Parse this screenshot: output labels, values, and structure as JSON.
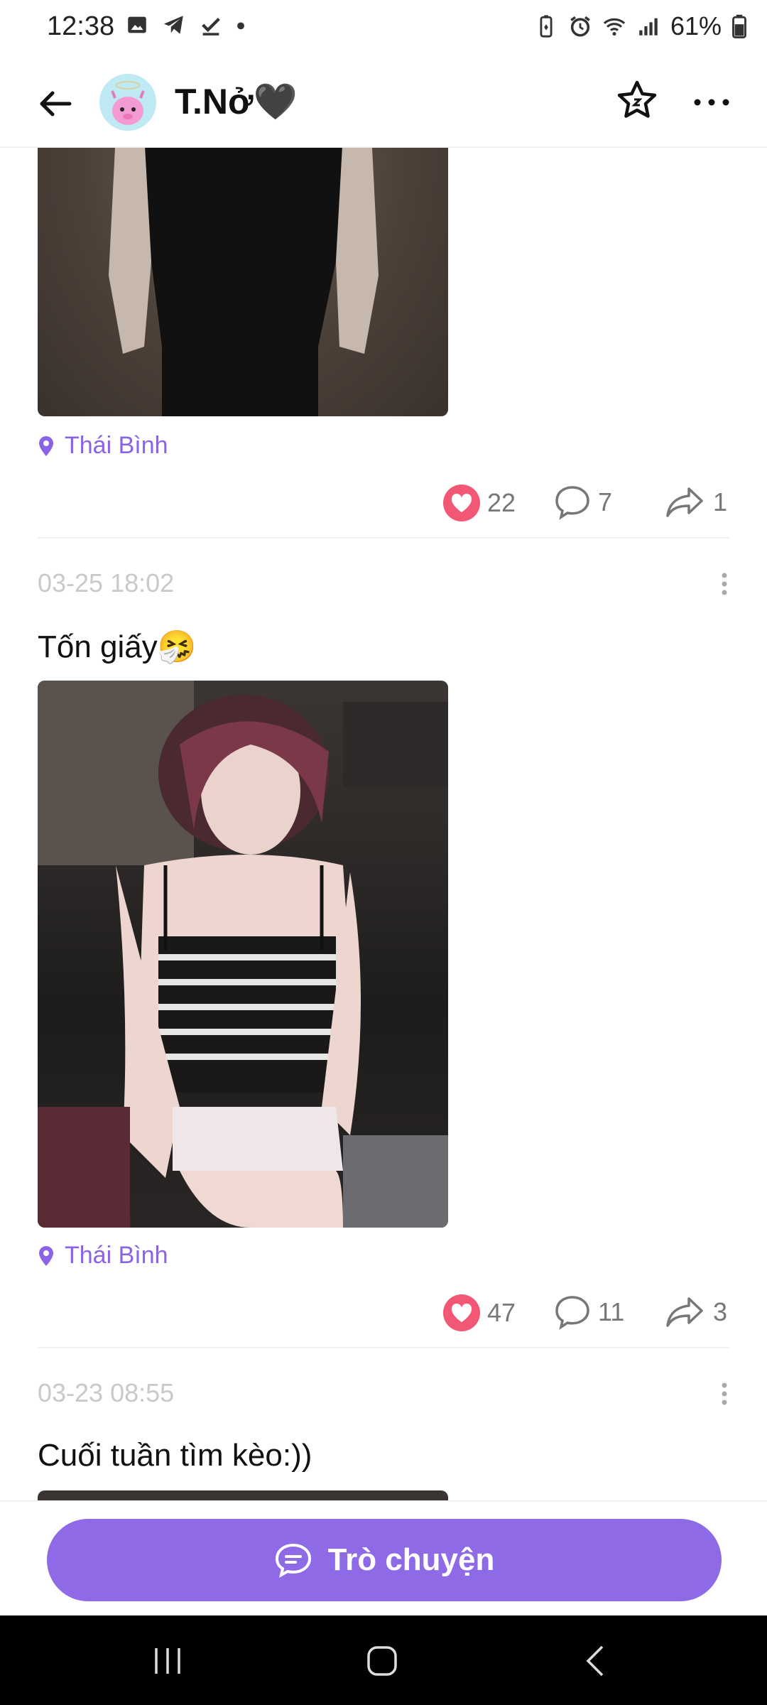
{
  "status_bar": {
    "time": "12:38",
    "battery_pct": "61%"
  },
  "header": {
    "title": "T.Nở🖤"
  },
  "posts": [
    {
      "location": "Thái Bình",
      "likes": "22",
      "comments": "7",
      "shares": "1"
    },
    {
      "date": "03-25 18:02",
      "caption": "Tốn giấy🤧",
      "location": "Thái Bình",
      "likes": "47",
      "comments": "11",
      "shares": "3"
    },
    {
      "date": "03-23 08:55",
      "caption": "Cuối tuần tìm kèo:))"
    }
  ],
  "chat_button": {
    "label": "Trò chuyện"
  },
  "colors": {
    "accent": "#8f6ae6",
    "like": "#f25775",
    "location": "#8a63e6"
  }
}
